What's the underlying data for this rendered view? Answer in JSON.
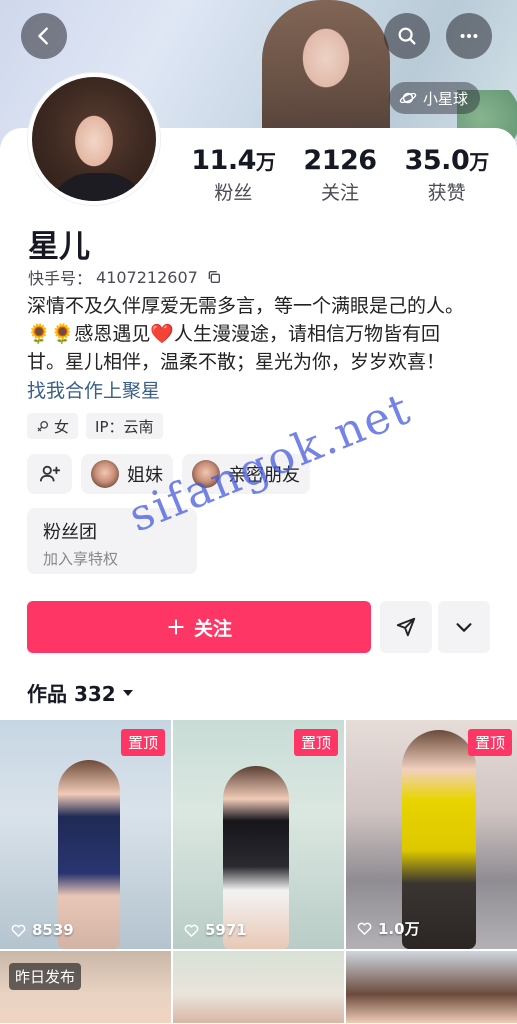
{
  "header": {
    "back_icon": "back-arrow-icon",
    "search_icon": "search-icon",
    "more_icon": "more-dots-icon",
    "planet_label": "小星球"
  },
  "profile": {
    "name": "星儿",
    "kuaishou_id_label": "快手号：",
    "kuaishou_id": "4107212607",
    "bio_line1": "深情不及久伴厚爱无需多言，等一个满眼是己的人。",
    "bio_line2": "🌻🌻感恩遇见❤️人生漫漫途，请相信万物皆有回",
    "bio_line3": "甘。星儿相伴，温柔不散；星光为你，岁岁欢喜！",
    "bio_link": "找我合作上聚星",
    "tag_gender": "女",
    "tag_ip": "IP：云南"
  },
  "stats": [
    {
      "value": "11.4",
      "unit": "万",
      "label": "粉丝"
    },
    {
      "value": "2126",
      "unit": "",
      "label": "关注"
    },
    {
      "value": "35.0",
      "unit": "万",
      "label": "获赞"
    }
  ],
  "social": {
    "sister_label": "姐妹",
    "friend_label": "亲密朋友"
  },
  "fan_club": {
    "title": "粉丝团",
    "subtitle": "加入享特权"
  },
  "watermark": "sifangok.net",
  "actions": {
    "follow_label": "关注"
  },
  "works": {
    "label": "作品 332"
  },
  "tiles": [
    {
      "badge": "置顶",
      "likes": "8539"
    },
    {
      "badge": "置顶",
      "likes": "5971"
    },
    {
      "badge": "置顶",
      "likes": "1.0万"
    },
    {
      "badge": "昨日发布",
      "likes": ""
    },
    {
      "badge": "",
      "likes": ""
    },
    {
      "badge": "",
      "likes": ""
    }
  ]
}
